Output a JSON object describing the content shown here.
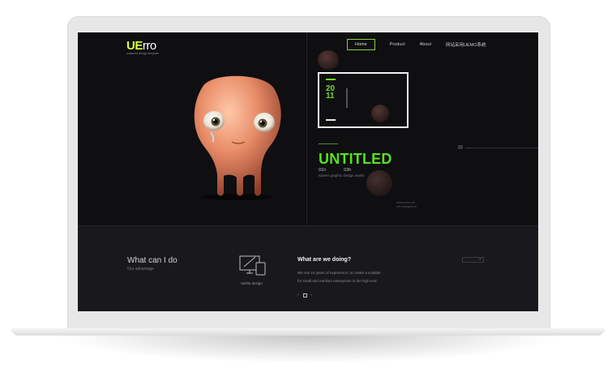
{
  "logo": {
    "mark_a": "UE",
    "mark_b": "rro",
    "tagline": "uclassics design template"
  },
  "nav": {
    "items": [
      "Home",
      "Product",
      "About",
      "网站采用UEMO系统"
    ],
    "active": 0
  },
  "hero": {
    "frame_number_top": "20",
    "frame_number_bottom": "11",
    "title": "UNTITLED",
    "meta_a": "01h",
    "meta_b": "03h",
    "meta_sub": "Xiaren graphic design works",
    "ghost_text": "www.uemo.net",
    "ghost_text_2": "web designer.cn"
  },
  "section": {
    "heading": "What can I do",
    "sub": "Our advantage",
    "service_label": "UE/ite design",
    "what_title": "What are we doing?",
    "what_line1": "We use 10 years of experience, to create a suitable",
    "what_line2": "for small and medium enterprises in the high-end",
    "more_label": "›",
    "pager_prev": "‹",
    "pager_next": "›"
  },
  "colors": {
    "accent_green": "#57e11e",
    "logo_yellow": "#d9ff3a",
    "background": "#121114"
  }
}
